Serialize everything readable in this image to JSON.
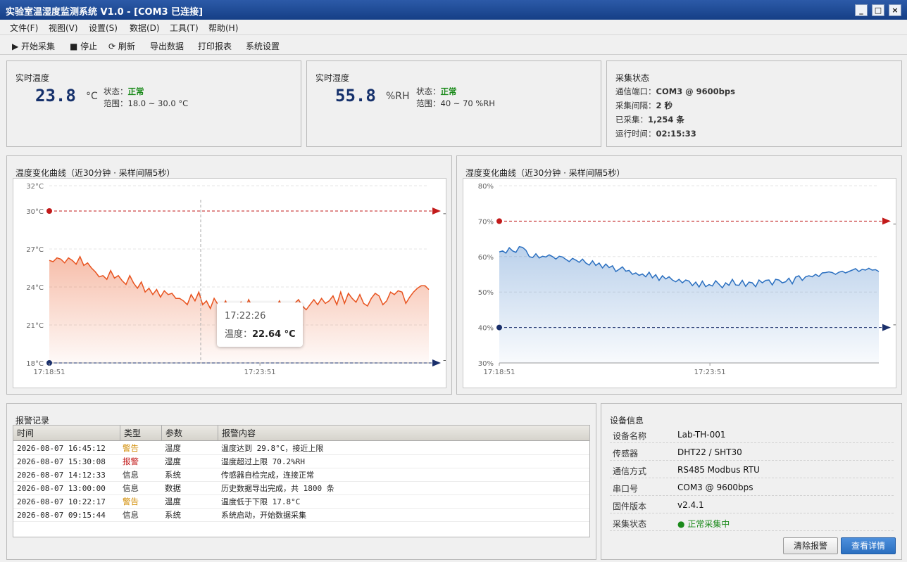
{
  "window": {
    "title": "实验室温湿度监测系统 V1.0 - [COM3 已连接]",
    "min": "_",
    "max": "□",
    "close": "×"
  },
  "menu": [
    "文件(F)",
    "视图(V)",
    "设置(S)",
    "数据(D)",
    "工具(T)",
    "帮助(H)"
  ],
  "toolbar": {
    "start": "▶ 开始采集",
    "stop": "■ 停止",
    "refresh": "⟳ 刷新",
    "export": "导出数据",
    "print": "打印报表",
    "settings": "系统设置"
  },
  "temp_card": {
    "title": "实时温度",
    "value": "23.8",
    "unit": "°C",
    "status_label": "状态：",
    "status": "正常",
    "range_label": "范围：",
    "range": "18.0 ~ 30.0 °C"
  },
  "hum_card": {
    "title": "实时湿度",
    "value": "55.8",
    "unit": "%RH",
    "status_label": "状态：",
    "status": "正常",
    "range_label": "范围：",
    "range": "40 ~ 70 %RH"
  },
  "acq": {
    "title": "采集状态",
    "port_label": "通信端口：",
    "port": "COM3 @ 9600bps",
    "interval_label": "采集间隔：",
    "interval": "2 秒",
    "count_label": "已采集：",
    "count": "1,254 条",
    "runtime_label": "运行时间：",
    "runtime": "02:15:33"
  },
  "tooltip": {
    "time": "17:22:26",
    "label": "温度：",
    "value": "22.64 °C"
  },
  "chart_data": [
    {
      "type": "area",
      "title": "温度变化曲线（近30分钟 · 采样间隔5秒）",
      "y_ticks": [
        "18°C",
        "21°C",
        "24°C",
        "27°C",
        "30°C",
        "32°C"
      ],
      "ylim": [
        18,
        32
      ],
      "x_ticks": [
        "17:18:51",
        "17:23:51"
      ],
      "upper_limit": 30,
      "lower_limit": 18,
      "upper_label": "上限",
      "lower_label": "下限",
      "color": "#e8531f",
      "values": [
        26.1,
        26.0,
        26.3,
        26.2,
        25.9,
        26.3,
        26.1,
        25.8,
        26.4,
        25.7,
        25.9,
        25.5,
        25.2,
        24.8,
        24.9,
        24.6,
        25.3,
        24.7,
        24.9,
        24.5,
        24.2,
        24.9,
        24.3,
        23.9,
        24.4,
        23.6,
        23.9,
        23.4,
        23.8,
        23.2,
        23.7,
        23.4,
        23.5,
        23.1,
        23.1,
        22.9,
        22.6,
        23.4,
        22.9,
        23.6,
        22.6,
        22.9,
        22.3,
        23.1,
        22.6,
        22.4,
        22.9,
        22.1,
        22.7,
        22.3,
        22.8,
        22.2,
        23.0,
        22.4,
        21.9,
        22.6,
        22.3,
        22.5,
        22.6,
        22.2,
        22.9,
        22.4,
        22.6,
        22.3,
        22.7,
        23.0,
        22.5,
        22.2,
        22.6,
        23.0,
        22.6,
        23.1,
        22.7,
        22.9,
        23.3,
        22.6,
        23.6,
        22.7,
        23.5,
        23.1,
        22.8,
        23.4,
        22.7,
        22.5,
        23.1,
        23.5,
        23.3,
        22.6,
        22.9,
        23.6,
        23.4,
        23.7,
        23.6,
        22.7,
        23.2,
        23.6,
        23.9,
        24.1,
        24.1,
        23.8
      ]
    },
    {
      "type": "area",
      "title": "湿度变化曲线（近30分钟 · 采样间隔5秒）",
      "y_ticks": [
        "30%",
        "40%",
        "50%",
        "60%",
        "70%",
        "80%"
      ],
      "ylim": [
        30,
        80
      ],
      "x_ticks": [
        "17:18:51",
        "17:23:51"
      ],
      "upper_limit": 70,
      "lower_limit": 40,
      "upper_label": "上限",
      "lower_label": "下限",
      "color": "#2a6fc0",
      "values": [
        61.3,
        61.6,
        61.0,
        62.5,
        61.6,
        61.2,
        62.8,
        62.6,
        61.8,
        60.0,
        59.7,
        60.8,
        59.6,
        60.1,
        59.9,
        60.5,
        60.0,
        59.3,
        60.1,
        59.9,
        59.2,
        58.6,
        59.5,
        59.0,
        58.4,
        59.3,
        58.2,
        57.6,
        58.8,
        57.5,
        58.2,
        56.8,
        57.9,
        56.9,
        57.4,
        55.8,
        56.4,
        57.1,
        55.9,
        56.1,
        55.0,
        55.4,
        54.7,
        55.1,
        54.3,
        55.6,
        54.0,
        54.9,
        53.3,
        54.6,
        53.7,
        54.3,
        53.4,
        52.9,
        53.6,
        52.6,
        53.4,
        53.1,
        51.8,
        52.8,
        51.4,
        53.1,
        51.5,
        52.1,
        51.7,
        53.2,
        52.2,
        51.2,
        52.6,
        51.9,
        53.6,
        52.0,
        51.9,
        53.3,
        51.6,
        52.8,
        52.6,
        51.5,
        53.4,
        52.6,
        53.3,
        53.4,
        52.0,
        53.6,
        53.4,
        52.6,
        52.9,
        53.9,
        52.3,
        54.2,
        54.6,
        53.3,
        54.3,
        54.6,
        54.3,
        55.0,
        54.4,
        55.4,
        55.5,
        55.7,
        55.5,
        55.0,
        55.6,
        55.9,
        55.4,
        55.8,
        56.2,
        56.6,
        55.8,
        56.4,
        56.2,
        56.7,
        56.2,
        56.3,
        55.8
      ]
    }
  ],
  "alarms": {
    "title": "报警记录",
    "headers": [
      "时间",
      "类型",
      "参数",
      "报警内容"
    ],
    "rows": [
      {
        "time": "2026-08-07 16:45:12",
        "type": "警告",
        "param": "温度",
        "msg": "温度达到 29.8°C，接近上限",
        "color": "#d18b00"
      },
      {
        "time": "2026-08-07 15:30:08",
        "type": "报警",
        "param": "湿度",
        "msg": "湿度超过上限 70.2%RH",
        "color": "#c21a1a"
      },
      {
        "time": "2026-08-07 14:12:33",
        "type": "信息",
        "param": "系统",
        "msg": "传感器自检完成，连接正常",
        "color": "#333333"
      },
      {
        "time": "2026-08-07 13:00:00",
        "type": "信息",
        "param": "数据",
        "msg": "历史数据导出完成，共 1800 条",
        "color": "#333333"
      },
      {
        "time": "2026-08-07 10:22:17",
        "type": "警告",
        "param": "温度",
        "msg": "温度低于下限 17.8°C",
        "color": "#d18b00"
      },
      {
        "time": "2026-08-07 09:15:44",
        "type": "信息",
        "param": "系统",
        "msg": "系统启动，开始数据采集",
        "color": "#333333"
      }
    ]
  },
  "device": {
    "title": "设备信息",
    "rows": [
      {
        "k": "设备名称",
        "v": "Lab-TH-001"
      },
      {
        "k": "传感器",
        "v": "DHT22 / SHT30"
      },
      {
        "k": "通信方式",
        "v": "RS485 Modbus RTU"
      },
      {
        "k": "串口号",
        "v": "COM3 @ 9600bps"
      },
      {
        "k": "固件版本",
        "v": "v2.4.1"
      },
      {
        "k": "采集状态",
        "v": "● 正常采集中"
      }
    ],
    "clear_btn": "清除报警",
    "detail_btn": "查看详情"
  }
}
